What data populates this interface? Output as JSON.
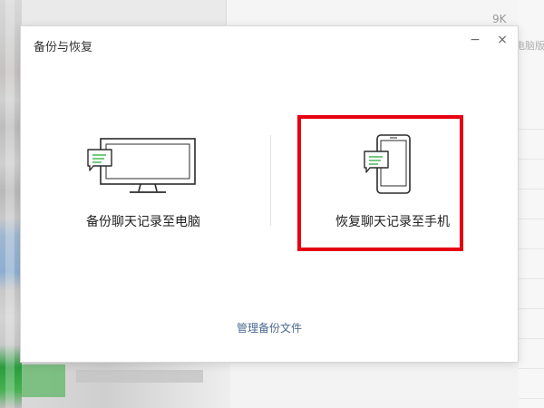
{
  "background": {
    "top_right_count": "9K",
    "top_right_version": "电脑版"
  },
  "dialog": {
    "title": "备份与恢复",
    "minimize_symbol": "−",
    "close_symbol": "×",
    "options": [
      {
        "label": "备份聊天记录至电脑",
        "icon": "monitor-with-chat-icon"
      },
      {
        "label": "恢复聊天记录至手机",
        "icon": "phone-with-chat-icon",
        "highlighted": true
      }
    ],
    "manage_link": "管理备份文件"
  },
  "colors": {
    "accent_green": "#3cb44b",
    "highlight_red": "#e60012",
    "link_blue": "#4a6a8f"
  }
}
